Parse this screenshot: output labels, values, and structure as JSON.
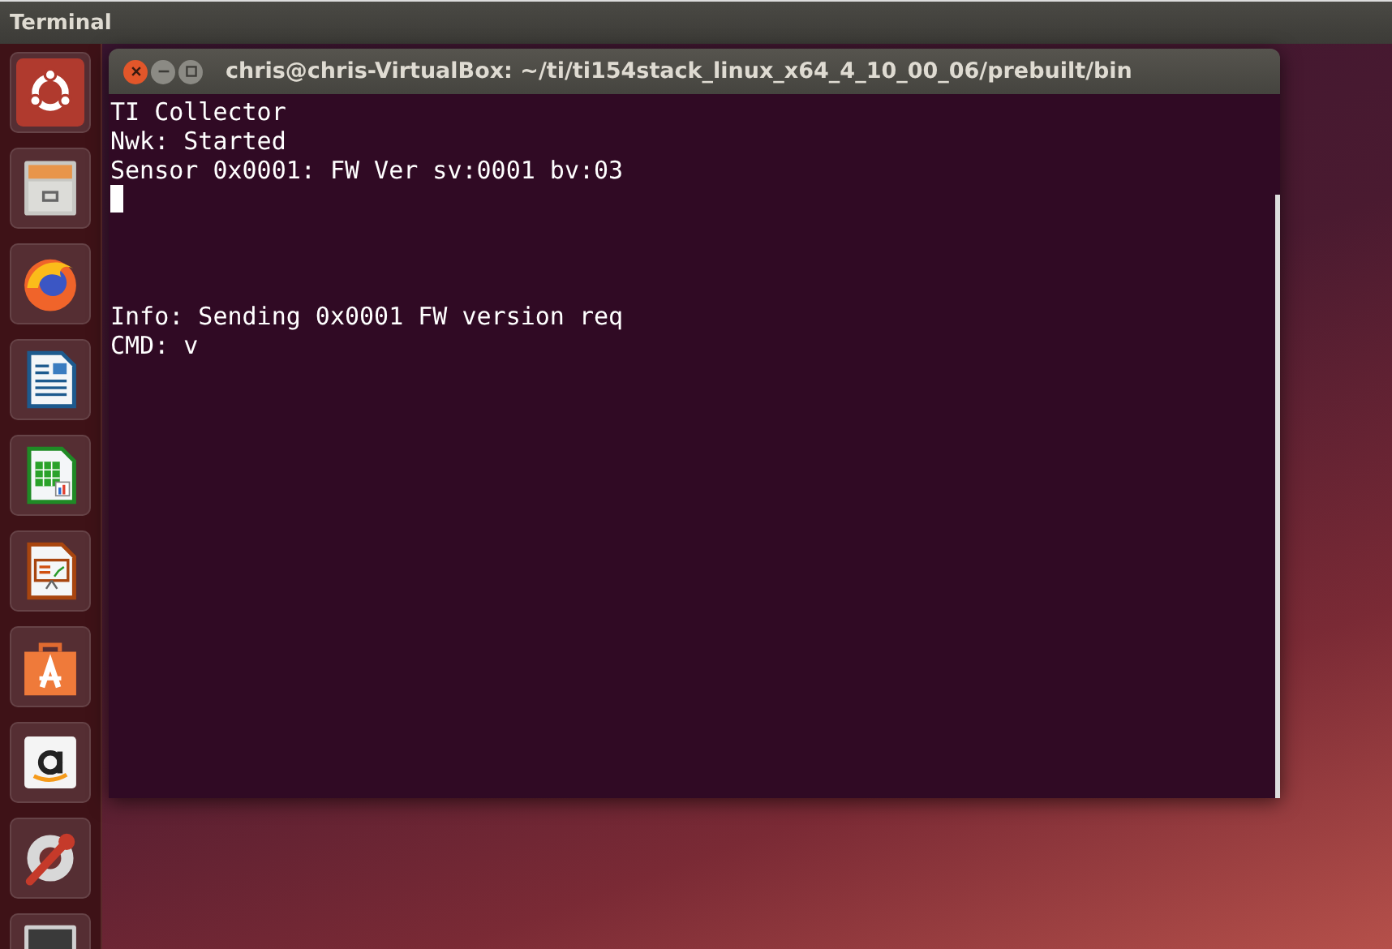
{
  "top_bar": {
    "title": "Terminal"
  },
  "window": {
    "title": "chris@chris-VirtualBox: ~/ti/ti154stack_linux_x64_4_10_00_06/prebuilt/bin",
    "focused": true
  },
  "terminal": {
    "lines": [
      {
        "kind": "text",
        "text": "TI Collector"
      },
      {
        "kind": "text",
        "text": "Nwk: Started"
      },
      {
        "kind": "text",
        "text": "Sensor 0x0001: FW Ver sv:0001 bv:03"
      },
      {
        "kind": "cursor"
      },
      {
        "kind": "blank"
      },
      {
        "kind": "blank"
      },
      {
        "kind": "blank"
      },
      {
        "kind": "text",
        "text": "Info: Sending 0x0001 FW version req"
      },
      {
        "kind": "text",
        "text": "CMD: v"
      }
    ]
  }
}
